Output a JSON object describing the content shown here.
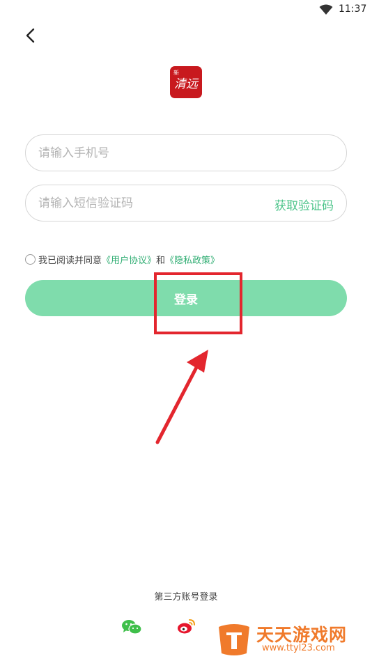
{
  "status_bar": {
    "time": "11:37",
    "wifi_icon": "wifi-icon"
  },
  "nav": {
    "back_icon": "chevron-left-icon"
  },
  "logo": {
    "text": "清远",
    "badge": "新"
  },
  "form": {
    "phone_placeholder": "请输入手机号",
    "code_placeholder": "请输入短信验证码",
    "get_code_label": "获取验证码"
  },
  "agreement": {
    "prefix": "我已阅读并同意",
    "user_agreement": "《用户协议》",
    "and": "和",
    "privacy_policy": "《隐私政策》"
  },
  "login_button": {
    "label": "登录"
  },
  "third_party": {
    "title": "第三方账号登录",
    "wechat_icon": "wechat-icon",
    "weibo_icon": "weibo-icon"
  },
  "watermark": {
    "name": "天天游戏网",
    "url": "www.ttyl23.com"
  },
  "colors": {
    "accent_green": "#4cc48a",
    "button_green": "#7fdcac",
    "annotation_red": "#e3262e",
    "logo_red": "#c8191e",
    "watermark_orange": "#f07a2b"
  }
}
